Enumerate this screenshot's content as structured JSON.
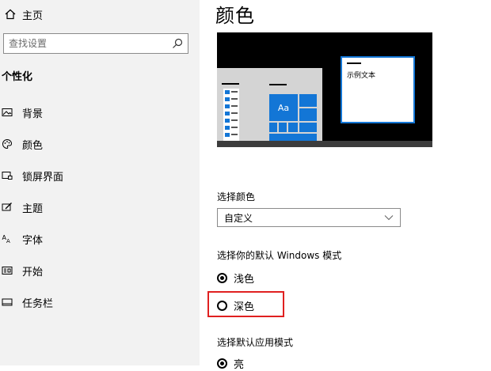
{
  "sidebar": {
    "home_label": "主页",
    "search_placeholder": "查找设置",
    "section_title": "个性化",
    "items": [
      {
        "label": "背景",
        "icon": "image-icon"
      },
      {
        "label": "颜色",
        "icon": "palette-icon"
      },
      {
        "label": "锁屏界面",
        "icon": "lock-screen-icon"
      },
      {
        "label": "主题",
        "icon": "theme-brush-icon"
      },
      {
        "label": "字体",
        "icon": "font-icon"
      },
      {
        "label": "开始",
        "icon": "start-menu-icon"
      },
      {
        "label": "任务栏",
        "icon": "taskbar-icon"
      }
    ]
  },
  "main": {
    "title": "颜色",
    "preview": {
      "sample_text": "示例文本",
      "tile_label": "Aa",
      "accent_color": "#1376d6"
    },
    "choose_color": {
      "label": "选择颜色",
      "selected": "自定义"
    },
    "windows_mode": {
      "label": "选择你的默认 Windows 模式",
      "options": [
        {
          "label": "浅色",
          "checked": true
        },
        {
          "label": "深色",
          "checked": false,
          "highlighted": true
        }
      ]
    },
    "app_mode": {
      "label": "选择默认应用模式",
      "options": [
        {
          "label": "亮",
          "checked": true
        }
      ]
    }
  },
  "highlight_color": "#e02020"
}
